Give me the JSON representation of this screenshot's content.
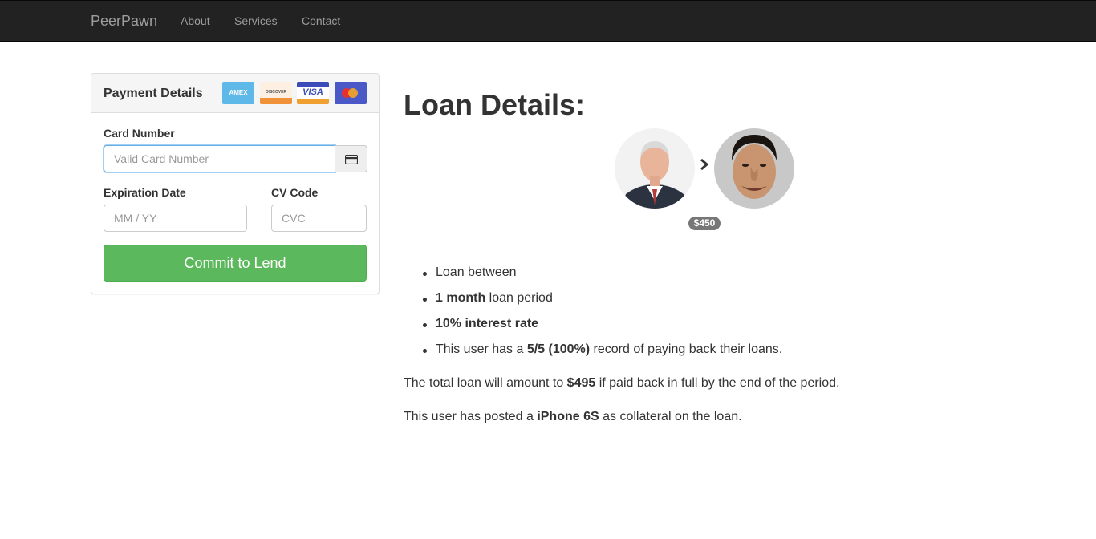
{
  "navbar": {
    "brand": "PeerPawn",
    "links": [
      "About",
      "Services",
      "Contact"
    ]
  },
  "payment": {
    "title": "Payment Details",
    "card_logos": [
      {
        "name": "AMEX",
        "color": "#5eb8e8"
      },
      {
        "name": "DISCOVER",
        "color": "#fbe8d3"
      },
      {
        "name": "VISA",
        "color": "#3b4cb8"
      },
      {
        "name": "mastercard",
        "color": "#4b59c8"
      }
    ],
    "card_number_label": "Card Number",
    "card_number_placeholder": "Valid Card Number",
    "expiration_label": "Expiration Date",
    "expiration_placeholder": "MM / YY",
    "cvc_label": "CV Code",
    "cvc_placeholder": "CVC",
    "submit_label": "Commit to Lend"
  },
  "loan": {
    "title": "Loan Details:",
    "amount_badge": "$450",
    "bullets": {
      "b1_text": "Loan between",
      "b2_bold": "1 month",
      "b2_rest": " loan period",
      "b3_bold": "10% interest rate",
      "b4_pre": "This user has a ",
      "b4_bold": "5/5 (100%)",
      "b4_post": " record of paying back their loans."
    },
    "total": {
      "pre": "The total loan will amount to ",
      "amount": "$495",
      "post": " if paid back in full by the end of the period."
    },
    "collateral": {
      "pre": "This user has posted a ",
      "item": "iPhone 6S",
      "post": " as collateral on the loan."
    }
  },
  "colors": {
    "navbar_bg": "#222222",
    "success": "#5cb85c",
    "badge": "#777777"
  }
}
